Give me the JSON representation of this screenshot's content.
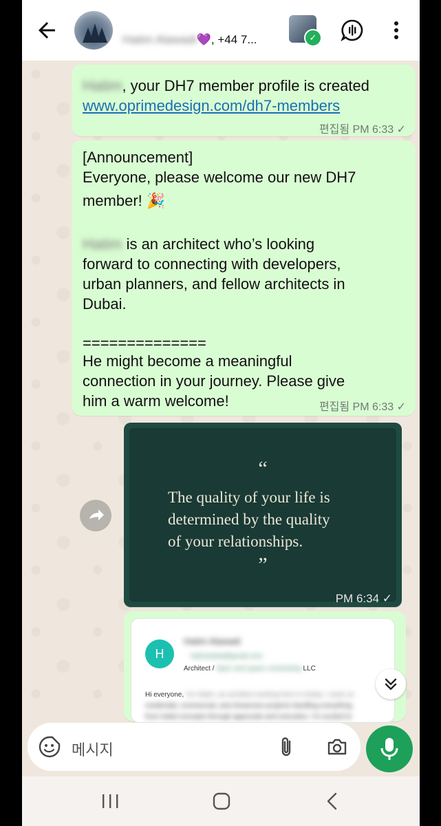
{
  "header": {
    "contact_name_redacted": "Hatim Alawadi",
    "contact_suffix": "💜, +44 7...",
    "icons": [
      "back-arrow-icon",
      "group-avatar",
      "verified-avatar",
      "voice-chat-icon",
      "more-vert-icon"
    ]
  },
  "messages": [
    {
      "redacted_name": "Hatim",
      "line1": ", your DH7 member profile is created",
      "link": "www.oprimedesign.com/dh7-members",
      "meta": "편집됨 PM 6:33 ✓"
    },
    {
      "lines": [
        "[Announcement]",
        "Everyone, please welcome our new DH7",
        "member! 🎉",
        "",
        " is an architect who’s looking",
        "forward to connecting with developers,",
        "urban planners, and fellow architects in",
        "Dubai.",
        "",
        "==============",
        "He might become a meaningful",
        "connection in your journey. Please give",
        "him a warm welcome!"
      ],
      "redacted_name": "Hatim",
      "meta": "편집됨 PM 6:33 ✓"
    },
    {
      "quote_open": "“",
      "quote_lines": [
        "The quality of your life is",
        "determined by the quality",
        "of your relationships."
      ],
      "quote_close": "”",
      "meta": "PM 6:34 ✓"
    },
    {
      "email": {
        "avatar_letter": "H",
        "sender_redacted": "Hatim Alawadi",
        "email_redacted": "hatimdubai@gmail.com",
        "role_prefix": "Architect / ",
        "company_redacted": "Spec and space contracting",
        "company_suffix": " LLC",
        "body_start": "Hi everyone, ",
        "body_redacted_1": "I'm Hatim, an architect working here in Dubai. I work on",
        "body_redacted_2": "residential, commercial, and showroom projects handling everything",
        "body_redacted_3": "from initial concepts through approvals and execution. I'm excited to"
      }
    }
  ],
  "composer": {
    "placeholder": "메시지",
    "icons": [
      "sticker-icon",
      "attach-icon",
      "camera-icon",
      "mic-icon"
    ]
  },
  "navbar": {
    "icons": [
      "recent-apps-icon",
      "home-icon",
      "back-nav-icon"
    ]
  },
  "colors": {
    "outgoing_bubble": "#d9fdd3",
    "chat_bg": "#efe7dd",
    "link": "#1a6fb3",
    "accent_green": "#1da05a",
    "quote_card": "#193a35"
  }
}
